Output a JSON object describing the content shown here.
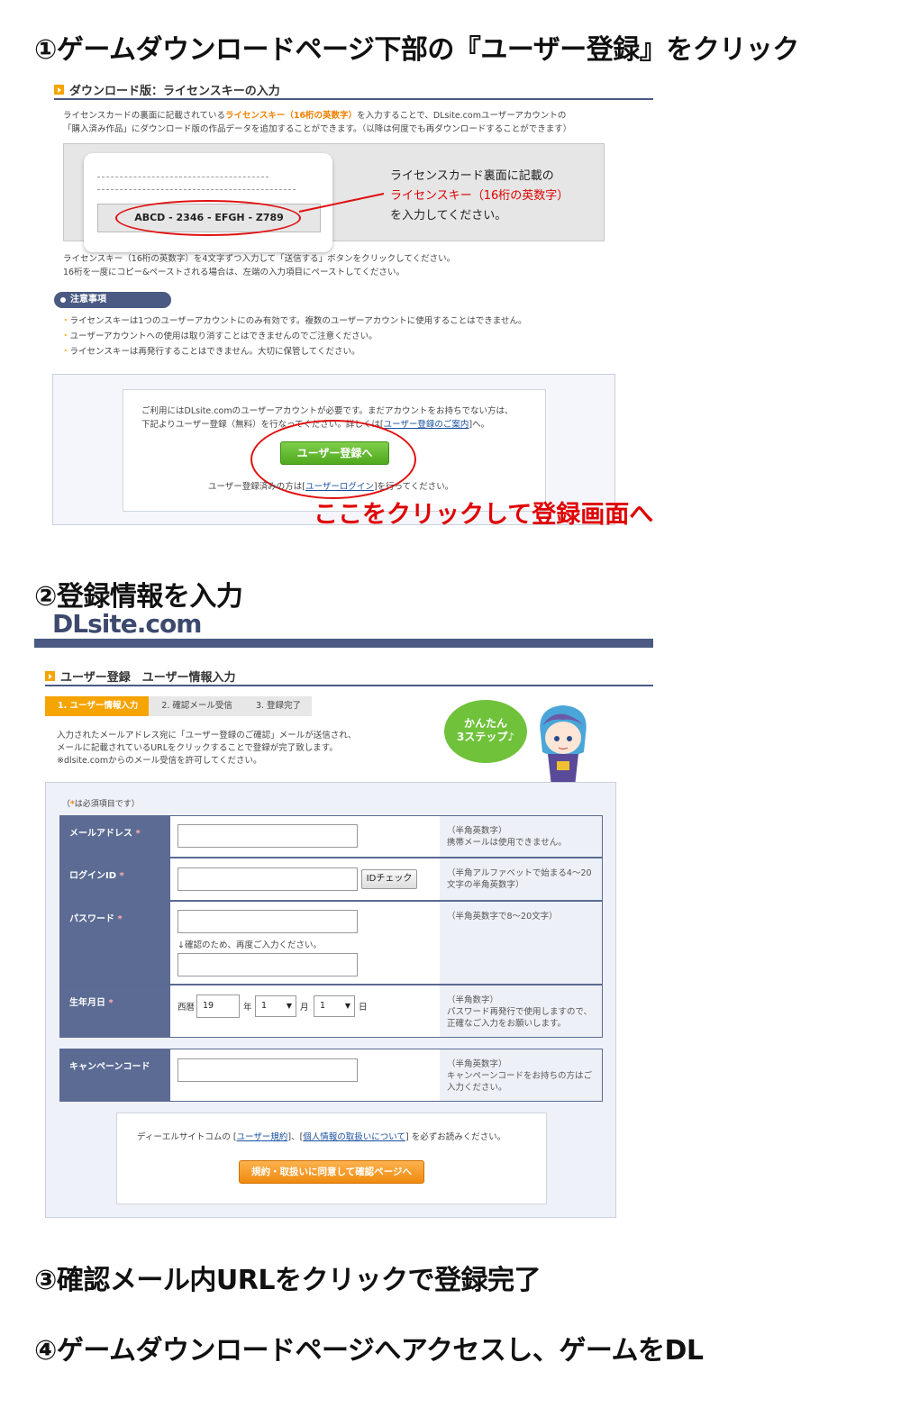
{
  "step1": {
    "heading": "①ゲームダウンロードページ下部の『ユーザー登録』をクリック",
    "section_title": "ダウンロード版：ライセンスキーの入力",
    "intro_line1_pre": "ライセンスカードの裏面に記載されている",
    "intro_line1_highlight": "ライセンスキー（16桁の英数字）",
    "intro_line1_post": "を入力することで、DLsite.comユーザーアカウントの",
    "intro_line2": "「購入済み作品」にダウンロード版の作品データを追加することができます。（以降は何度でも再ダウンロードすることができます）",
    "card_key": "ABCD - 2346 - EFGH - Z789",
    "callout_line1": "ライセンスカード裏面に記載の",
    "callout_line2": "ライセンスキー（16桁の英数字）",
    "callout_line3": "を入力してください。",
    "instr_line1": "ライセンスキー（16桁の英数字）を4文字ずつ入力して「送信する」ボタンをクリックしてください。",
    "instr_line2": "16桁を一度にコピー&ペーストされる場合は、左端の入力項目にペーストしてください。",
    "notes_label": "注意事項",
    "notes": [
      "ライセンスキーは1つのユーザーアカウントにのみ有効です。複数のユーザーアカウントに使用することはできません。",
      "ユーザーアカウントへの使用は取り消すことはできませんのでご注意ください。",
      "ライセンスキーは再発行することはできません。大切に保管してください。"
    ],
    "box_line1": "ご利用にはDLsite.comのユーザーアカウントが必要です。まだアカウントをお持ちでない方は、",
    "box_line2_pre": "下記よりユーザー登録（無料）を行なってください。詳しくは[",
    "box_line2_link": "ユーザー登録のご案内",
    "box_line2_post": "]へ。",
    "register_button": "ユーザー登録へ",
    "login_pre": "ユーザー登録済みの方は[",
    "login_link": "ユーザーログイン",
    "login_post": "]を行ってください。",
    "cta": "ここをクリックして登録画面へ"
  },
  "step2": {
    "heading": "②登録情報を入力",
    "logo": "DLsite.com",
    "section_title": "ユーザー登録　ユーザー情報入力",
    "steps": [
      "1. ユーザー情報入力",
      "2. 確認メール受信",
      "3. 登録完了"
    ],
    "bubble_line1": "かんたん",
    "bubble_line2": "3ステップ♪",
    "intro_line1": "入力されたメールアドレス宛に「ユーザー登録のご確認」メールが送信され、",
    "intro_line2": "メールに記載されているURLをクリックすることで登録が完了致します。",
    "intro_line3": "※dlsite.comからのメール受信を許可してください。",
    "required_note_pre": "（",
    "required_note_mark": "*",
    "required_note_post": "は必須項目です）",
    "fields": {
      "email": {
        "label": "メールアドレス",
        "hint1": "（半角英数字）",
        "hint2": "携帯メールは使用できません。"
      },
      "login": {
        "label": "ログインID",
        "id_check": "IDチェック",
        "hint1": "（半角アルファベットで始まる4～20",
        "hint2": "文字の半角英数字）"
      },
      "password": {
        "label": "パスワード",
        "confirm_note": "↓確認のため、再度ご入力ください。",
        "hint1": "（半角英数字で8～20文字）"
      },
      "birthday": {
        "label": "生年月日",
        "era": "西暦",
        "year_value": "19",
        "year_unit": "年",
        "month_value": "1",
        "month_unit": "月",
        "day_value": "1",
        "day_unit": "日",
        "hint1": "（半角数字）",
        "hint2": "パスワード再発行で使用しますので、",
        "hint3": "正確なご入力をお願いします。"
      },
      "campaign": {
        "label": "キャンペーンコード",
        "hint1": "（半角英数字）",
        "hint2": "キャンペーンコードをお持ちの方はご",
        "hint3": "入力ください。"
      }
    },
    "required_mark": "*",
    "terms_pre": "ディーエルサイトコムの [",
    "terms_link1": "ユーザー規約",
    "terms_mid": "]、[",
    "terms_link2": "個人情報の取扱いについて",
    "terms_post": "] を必ずお読みください。",
    "agree_button": "規約・取扱いに同意して確認ページへ"
  },
  "step3": {
    "heading": "③確認メール内URLをクリックで登録完了"
  },
  "step4": {
    "heading": "④ゲームダウンロードページへアクセスし、ゲームをDL"
  }
}
